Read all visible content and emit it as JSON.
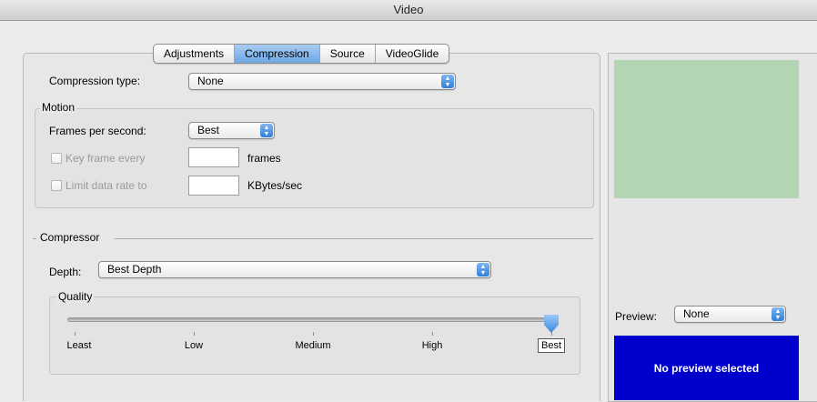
{
  "window": {
    "title": "Video"
  },
  "tabs": [
    {
      "label": "Adjustments",
      "active": false
    },
    {
      "label": "Compression",
      "active": true
    },
    {
      "label": "Source",
      "active": false
    },
    {
      "label": "VideoGlide",
      "active": false
    }
  ],
  "compression": {
    "label": "Compression type:",
    "value": "None"
  },
  "motion": {
    "group_label": "Motion",
    "fps_label": "Frames per second:",
    "fps_value": "Best",
    "keyframe_label": "Key frame every",
    "keyframe_value": "",
    "keyframe_unit": "frames",
    "limit_label": "Limit data rate to",
    "limit_value": "",
    "limit_unit": "KBytes/sec"
  },
  "compressor": {
    "section_label": "Compressor",
    "depth_label": "Depth:",
    "depth_value": "Best Depth",
    "quality": {
      "group_label": "Quality",
      "ticks": [
        "Least",
        "Low",
        "Medium",
        "High",
        "Best"
      ],
      "selected": "Best",
      "level": 1.0
    }
  },
  "preview": {
    "label": "Preview:",
    "value": "None",
    "message": "No preview selected",
    "image_color": "#b3d5b3",
    "message_bg": "#0000cc"
  },
  "colors": {
    "accent": "#4a90e2"
  }
}
